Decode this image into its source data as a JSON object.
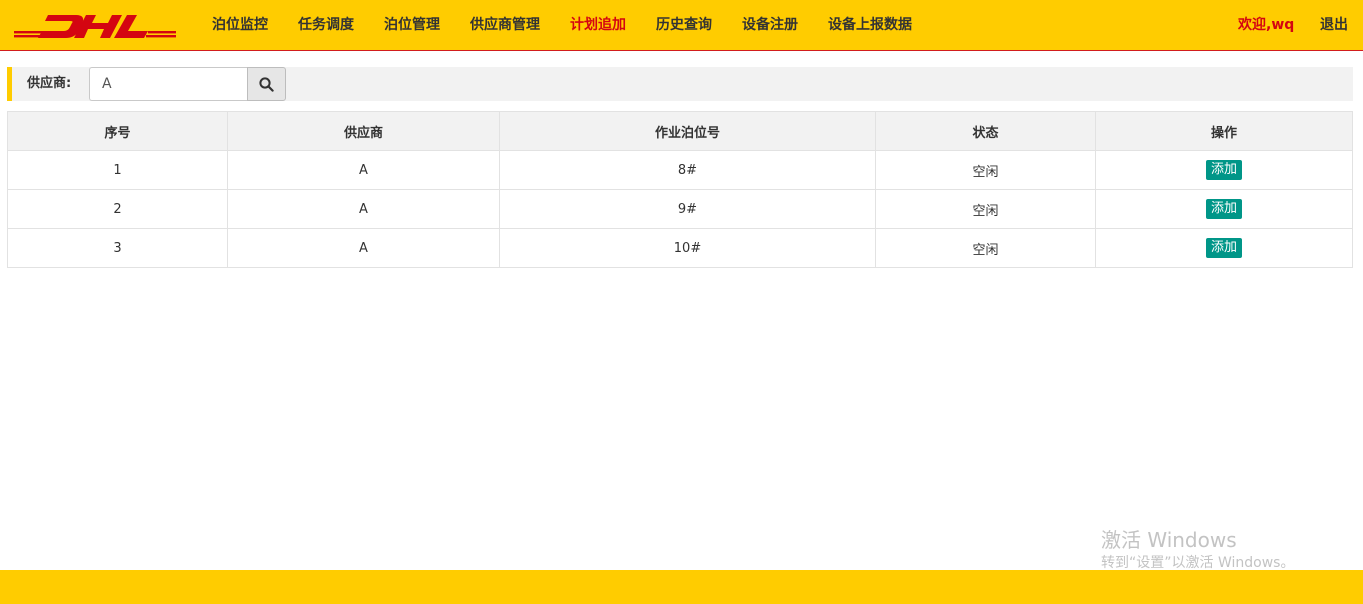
{
  "header": {
    "logo_text": "DHL",
    "nav": [
      {
        "label": "泊位监控"
      },
      {
        "label": "任务调度"
      },
      {
        "label": "泊位管理"
      },
      {
        "label": "供应商管理"
      },
      {
        "label": "计划追加",
        "active": true
      },
      {
        "label": "历史查询"
      },
      {
        "label": "设备注册"
      },
      {
        "label": "设备上报数据"
      }
    ],
    "welcome": "欢迎,wq",
    "logout": "退出"
  },
  "search": {
    "label": "供应商:",
    "value": "A",
    "button_icon": "search-icon"
  },
  "table": {
    "columns": [
      "序号",
      "供应商",
      "作业泊位号",
      "状态",
      "操作"
    ],
    "rows": [
      {
        "index": "1",
        "supplier": "A",
        "berth": "8#",
        "status": "空闲",
        "action": "添加"
      },
      {
        "index": "2",
        "supplier": "A",
        "berth": "9#",
        "status": "空闲",
        "action": "添加"
      },
      {
        "index": "3",
        "supplier": "A",
        "berth": "10#",
        "status": "空闲",
        "action": "添加"
      }
    ]
  },
  "watermark": {
    "title": "激活 Windows",
    "subtitle": "转到“设置”以激活 Windows。"
  },
  "colors": {
    "brand_yellow": "#ffcc00",
    "brand_red": "#d40511",
    "action_green": "#009688",
    "status_green": "#2e8b2e"
  }
}
